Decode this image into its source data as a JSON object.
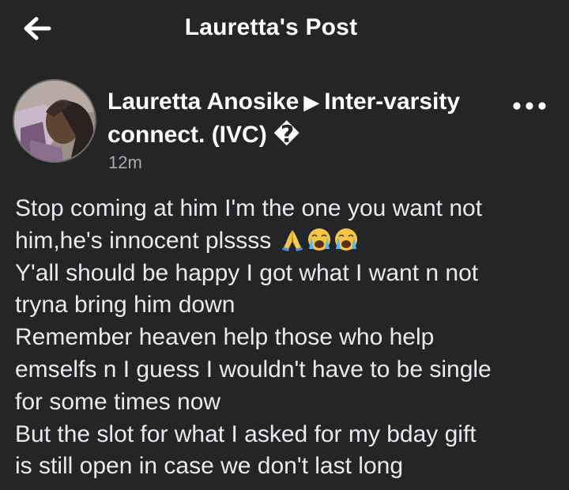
{
  "header": {
    "title": "Lauretta's Post",
    "back_icon": "arrow-left-icon"
  },
  "post": {
    "author": "Lauretta Anosike",
    "arrow_glyph": "▶",
    "group_line1": "Inter-varsity",
    "group_line2": "connect. (IVC)",
    "group_suffix_glyph": "�",
    "timestamp": "12m",
    "more_icon": "more-horizontal-icon",
    "body": {
      "line1": "Stop coming at him I'm the one you want not",
      "line2": "him,he's innocent plssss",
      "line2_emojis": [
        "folded-hands-emoji",
        "crying-face-emoji",
        "crying-face-emoji"
      ],
      "line3": "Y'all should be happy I got what I want n not",
      "line4": "tryna bring him down",
      "line5": "Remember heaven help those who help",
      "line6": "emselfs n I guess I wouldn't have to be single",
      "line7": "for some times now",
      "line8": "But the slot for what I asked for my bday gift",
      "line9": "is still open in case we don't last long"
    }
  },
  "colors": {
    "background": "#242526",
    "text_primary": "#ffffff",
    "text_body": "#e9eaed",
    "text_secondary": "#a9abb0"
  }
}
